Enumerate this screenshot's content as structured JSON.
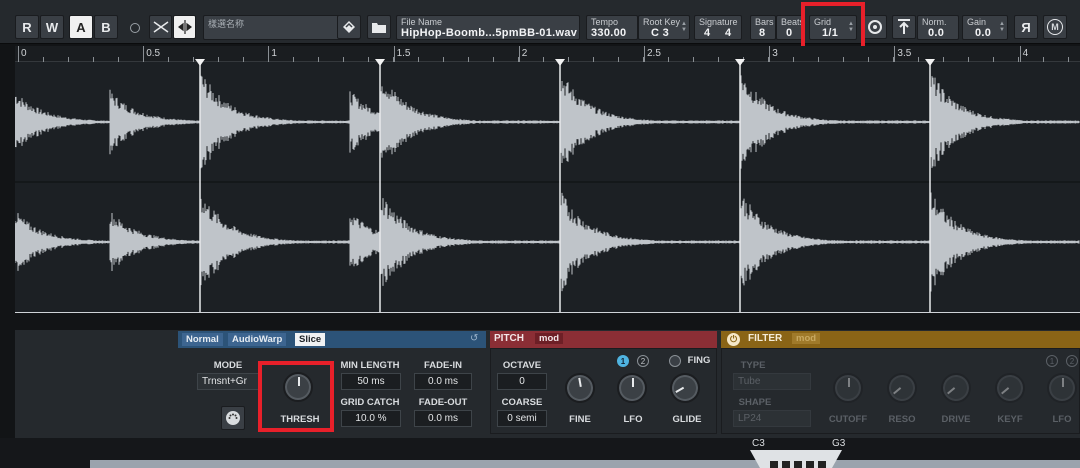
{
  "toolbar": {
    "r_label": "R",
    "w_label": "W",
    "a_label": "A",
    "b_label": "B",
    "sample_name_placeholder": "樣選名称",
    "file_name_label": "File Name",
    "file_name_value": "HipHop-Boomb...5pmBB-01.wav",
    "tempo_label": "Tempo",
    "tempo_value": "330.00",
    "root_key_label": "Root Key",
    "root_key_value": "C 3",
    "signature_label": "Signature",
    "signature_num": "4",
    "signature_den": "4",
    "bars_label": "Bars",
    "bars_value": "8",
    "beats_label": "Beats",
    "beats_value": "0",
    "grid_label": "Grid",
    "grid_value": "1/1",
    "norm_label": "Norm.",
    "norm_value": "0.0",
    "gain_label": "Gain",
    "gain_value": "0.0",
    "reverse_label": "Я",
    "m_label": "M"
  },
  "ruler": {
    "ticks": [
      "0",
      "0.5",
      "1",
      "1.5",
      "2",
      "2.5",
      "3",
      "3.5",
      "4"
    ]
  },
  "warp": {
    "tabs": [
      "Normal",
      "AudioWarp",
      "Slice"
    ],
    "active_tab": "Slice",
    "mode_label": "MODE",
    "mode_value": "Trnsnt+Gr",
    "thresh_label": "THRESH",
    "min_length_label": "MIN LENGTH",
    "min_length_value": "50 ms",
    "fade_in_label": "FADE-IN",
    "fade_in_value": "0.0 ms",
    "grid_catch_label": "GRID CATCH",
    "grid_catch_value": "10.0 %",
    "fade_out_label": "FADE-OUT",
    "fade_out_value": "0.0 ms"
  },
  "pitch": {
    "title": "PITCH",
    "mod_label": "mod",
    "octave_label": "OCTAVE",
    "octave_value": "0",
    "coarse_label": "COARSE",
    "coarse_value": "0 semi",
    "fine_label": "FINE",
    "lfo_label": "LFO",
    "glide_label": "GLIDE",
    "lfo1": "1",
    "lfo2": "2",
    "fing_label": "FING"
  },
  "filter": {
    "title": "FILTER",
    "mod_label": "mod",
    "type_label": "TYPE",
    "type_value": "Tube",
    "shape_label": "SHAPE",
    "shape_value": "LP24",
    "cutoff_label": "CUTOFF",
    "reso_label": "RESO",
    "drive_label": "DRIVE",
    "keyf_label": "KEYF",
    "lfo_label": "LFO",
    "lfo1": "1",
    "lfo2": "2"
  },
  "keyboard": {
    "low_key": "C3",
    "high_key": "G3"
  },
  "colors": {
    "pitch_header": "#8b2e35",
    "filter_header": "#8a6416",
    "warp_header": "#2c5378",
    "highlight": "#e8202a",
    "waveform": "#bfc4c9"
  }
}
